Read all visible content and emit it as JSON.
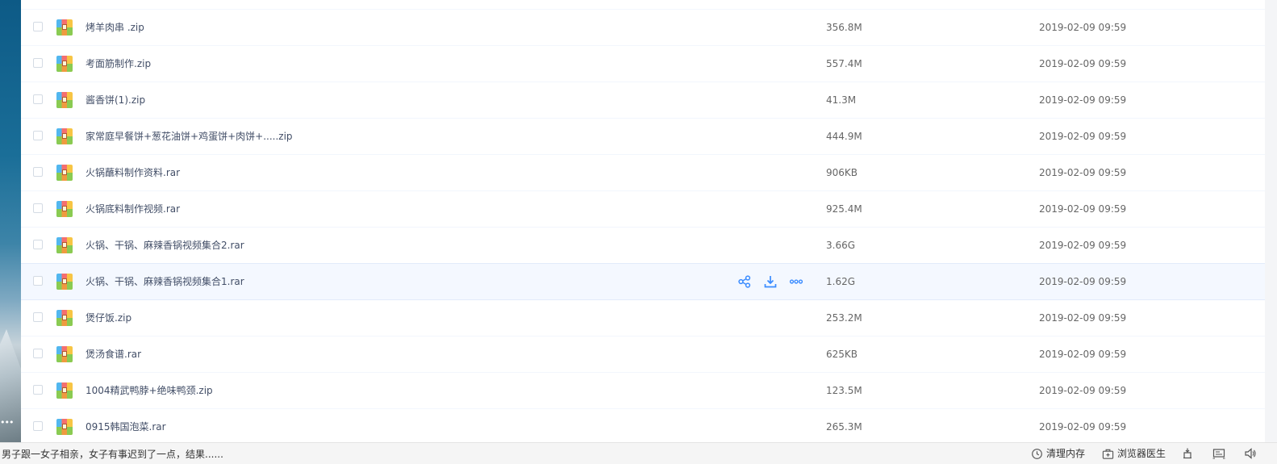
{
  "file_list": {
    "rows": [
      {
        "name": "烤羊肉串 .zip",
        "size": "356.8M",
        "date": "2019-02-09 09:59",
        "icon": "zip-archive-icon"
      },
      {
        "name": "考面筋制作.zip",
        "size": "557.4M",
        "date": "2019-02-09 09:59",
        "icon": "zip-archive-icon"
      },
      {
        "name": "酱香饼(1).zip",
        "size": "41.3M",
        "date": "2019-02-09 09:59",
        "icon": "zip-archive-icon"
      },
      {
        "name": "家常庭早餐饼+葱花油饼+鸡蛋饼+肉饼+.....zip",
        "size": "444.9M",
        "date": "2019-02-09 09:59",
        "icon": "zip-archive-icon"
      },
      {
        "name": "火锅蘸料制作资料.rar",
        "size": "906KB",
        "date": "2019-02-09 09:59",
        "icon": "rar-archive-icon"
      },
      {
        "name": "火锅底料制作视频.rar",
        "size": "925.4M",
        "date": "2019-02-09 09:59",
        "icon": "rar-archive-icon"
      },
      {
        "name": "火锅、干锅、麻辣香锅视频集合2.rar",
        "size": "3.66G",
        "date": "2019-02-09 09:59",
        "icon": "rar-archive-icon"
      },
      {
        "name": "火锅、干锅、麻辣香锅视频集合1.rar",
        "size": "1.62G",
        "date": "2019-02-09 09:59",
        "icon": "rar-archive-icon",
        "hovered": true
      },
      {
        "name": "煲仔饭.zip",
        "size": "253.2M",
        "date": "2019-02-09 09:59",
        "icon": "zip-archive-icon"
      },
      {
        "name": "煲汤食谱.rar",
        "size": "625KB",
        "date": "2019-02-09 09:59",
        "icon": "rar-archive-icon"
      },
      {
        "name": "1004精武鸭脖+绝味鸭颈.zip",
        "size": "123.5M",
        "date": "2019-02-09 09:59",
        "icon": "zip-archive-icon"
      },
      {
        "name": "0915韩国泡菜.rar",
        "size": "265.3M",
        "date": "2019-02-09 09:59",
        "icon": "rar-archive-icon"
      }
    ],
    "row_actions": [
      {
        "icon": "share-icon"
      },
      {
        "icon": "download-icon"
      },
      {
        "icon": "more-icon"
      }
    ]
  },
  "status_bar": {
    "news": "男子跟一女子相亲，女子有事迟到了一点，结果......",
    "clear_memory": {
      "label": "清理内存",
      "icon": "clock-icon"
    },
    "browser_doctor": {
      "label": "浏览器医生",
      "icon": "doctor-bag-icon"
    },
    "extra_icons": [
      "download-manager-icon",
      "screen-icon",
      "speaker-icon"
    ]
  },
  "colors": {
    "accent": "#3b8cff",
    "row_hover": "#f4f8ff",
    "text": "#424e67"
  }
}
